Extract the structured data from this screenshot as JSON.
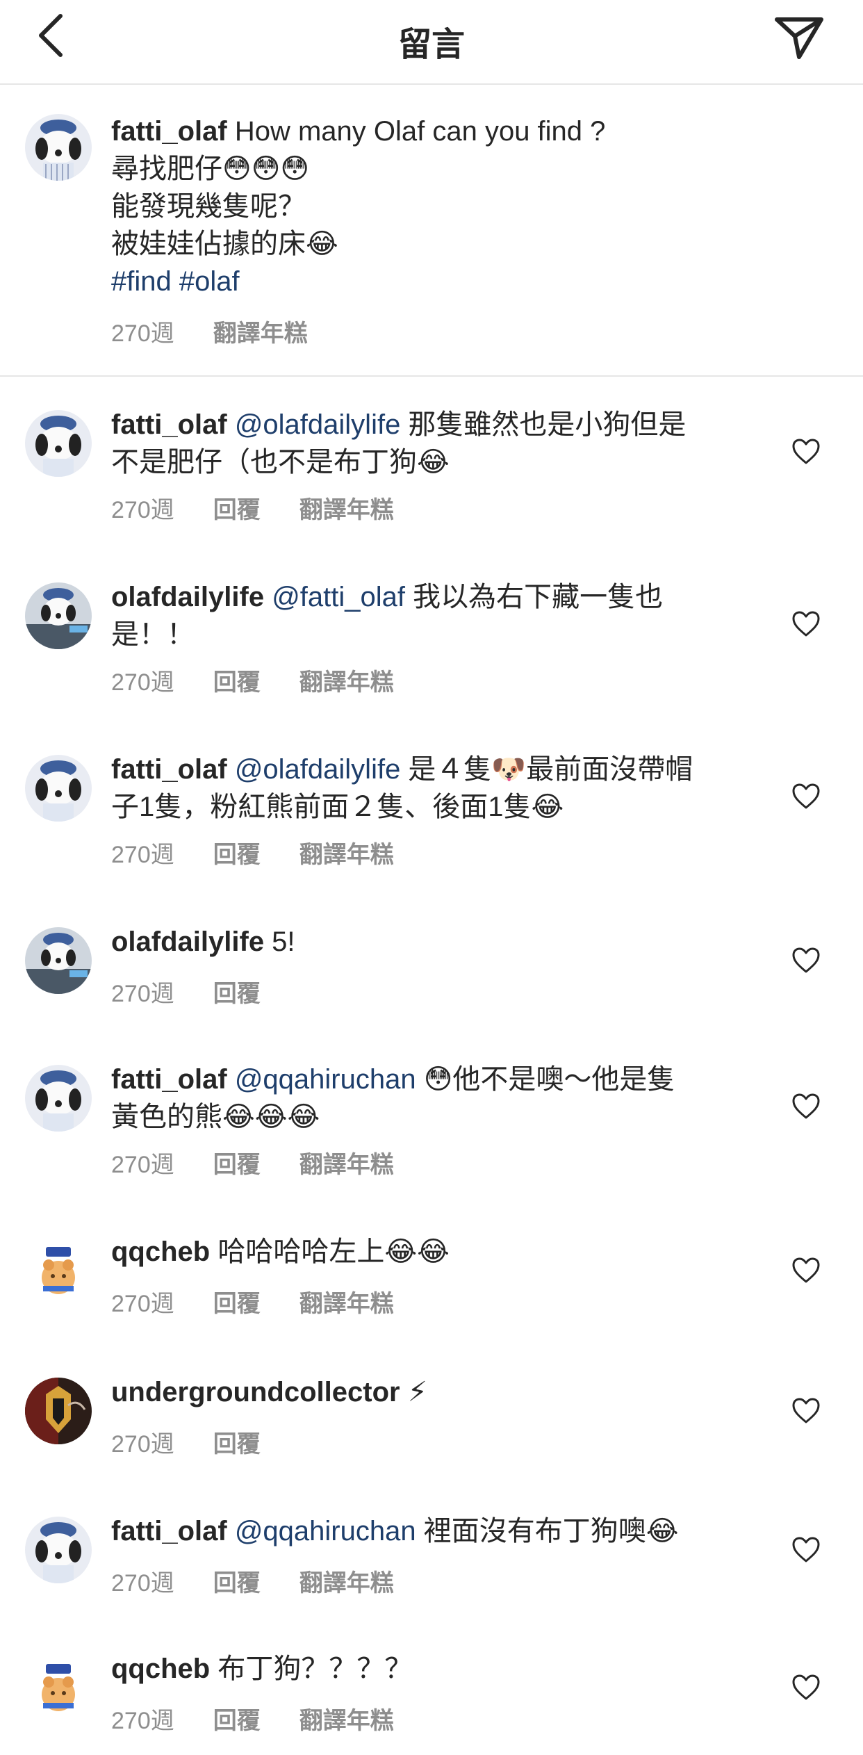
{
  "header": {
    "title": "留言"
  },
  "caption": {
    "username": "fatti_olaf",
    "line1": "How many Olaf can you find ?",
    "line2": "尋找肥仔😳😳😳",
    "line3": "能發現幾隻呢？",
    "line4": "被娃娃佔據的床😂",
    "hashtag1": "#find",
    "hashtag2": "#olaf",
    "time": "270週",
    "translate": "翻譯年糕"
  },
  "comments": [
    {
      "username": "fatti_olaf",
      "mention": "@olafdailylife",
      "text": " 那隻雖然也是小狗但是",
      "text2": "不是肥仔（也不是布丁狗😂",
      "time": "270週",
      "reply": "回覆",
      "translate": "翻譯年糕"
    },
    {
      "username": "olafdailylife",
      "mention": "@fatti_olaf",
      "text": " 我以為右下藏一隻也",
      "text2": "是！！",
      "time": "270週",
      "reply": "回覆",
      "translate": "翻譯年糕"
    },
    {
      "username": "fatti_olaf",
      "mention": "@olafdailylife",
      "text": " 是４隻🐶最前面沒帶帽",
      "text2": "子1隻，粉紅熊前面２隻、後面1隻😂",
      "time": "270週",
      "reply": "回覆",
      "translate": "翻譯年糕"
    },
    {
      "username": "olafdailylife",
      "mention": "",
      "text": " 5!",
      "text2": "",
      "time": "270週",
      "reply": "回覆",
      "translate": ""
    },
    {
      "username": "fatti_olaf",
      "mention": "@qqahiruchan",
      "text": " 😳他不是噢～他是隻",
      "text2": "黃色的熊😂😂😂",
      "time": "270週",
      "reply": "回覆",
      "translate": "翻譯年糕"
    },
    {
      "username": "qqcheb",
      "mention": "",
      "text": " 哈哈哈哈左上😂😂",
      "text2": "",
      "time": "270週",
      "reply": "回覆",
      "translate": "翻譯年糕"
    },
    {
      "username": "undergroundcollector",
      "mention": "",
      "text": " ⚡",
      "text2": "",
      "time": "270週",
      "reply": "回覆",
      "translate": ""
    },
    {
      "username": "fatti_olaf",
      "mention": "@qqahiruchan",
      "text": " 裡面沒有布丁狗噢😂",
      "text2": "",
      "time": "270週",
      "reply": "回覆",
      "translate": "翻譯年糕"
    },
    {
      "username": "qqcheb",
      "mention": "",
      "text": " 布丁狗？？？？",
      "text2": "",
      "time": "270週",
      "reply": "回覆",
      "translate": "翻譯年糕"
    }
  ],
  "icons": {
    "back": "chevron-left-icon",
    "send": "paper-plane-icon",
    "heart": "heart-outline-icon"
  },
  "colors": {
    "text": "#262626",
    "secondary": "#8e8e8e",
    "link": "#1e3e6b",
    "divider": "#e6e6e6"
  }
}
